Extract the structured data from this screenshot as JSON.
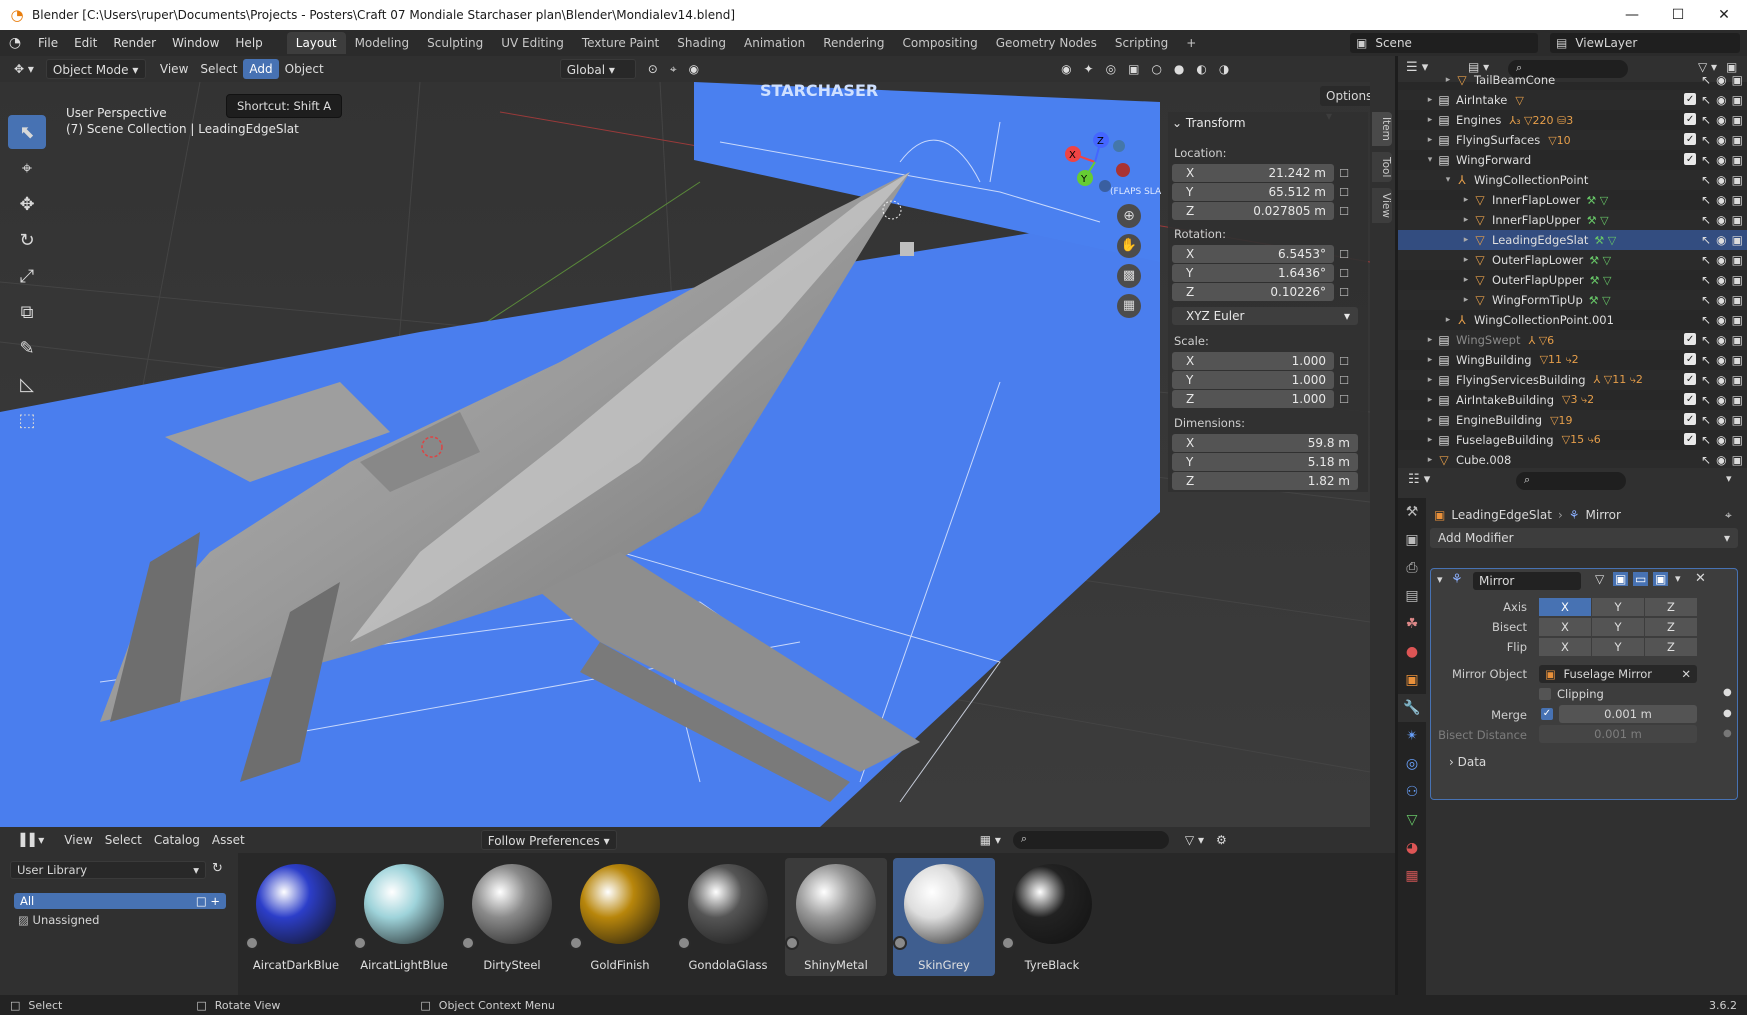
{
  "titlebar": {
    "title": "Blender [C:\\Users\\ruper\\Documents\\Projects - Posters\\Craft 07 Mondiale Starchaser plan\\Blender\\Mondialev14.blend]",
    "minimize": "—",
    "maximize": "☐",
    "close": "✕"
  },
  "menu": {
    "items": [
      "File",
      "Edit",
      "Render",
      "Window",
      "Help"
    ],
    "workspaces": [
      "Layout",
      "Modeling",
      "Sculpting",
      "UV Editing",
      "Texture Paint",
      "Shading",
      "Animation",
      "Rendering",
      "Compositing",
      "Geometry Nodes",
      "Scripting"
    ],
    "active_workspace": "Layout",
    "add_workspace": "+",
    "scene": "Scene",
    "view_layer": "ViewLayer"
  },
  "viewport_header": {
    "mode": "Object Mode",
    "menus": [
      "View",
      "Select",
      "Add",
      "Object"
    ],
    "active_menu": "Add",
    "orientation": "Global",
    "options": "Options"
  },
  "viewport": {
    "view_name": "User Perspective",
    "collection_info": "(7) Scene Collection | LeadingEdgeSlat",
    "tooltip": "Shortcut: Shift A",
    "blueprint_title": "STARCHASER",
    "blueprint_note": "(FLAPS SLA",
    "gizmo": {
      "x": "X",
      "y": "Y",
      "z": "Z"
    }
  },
  "transform": {
    "header": "Transform",
    "location_label": "Location:",
    "location": [
      {
        "axis": "X",
        "value": "21.242 m"
      },
      {
        "axis": "Y",
        "value": "65.512 m"
      },
      {
        "axis": "Z",
        "value": "0.027805 m"
      }
    ],
    "rotation_label": "Rotation:",
    "rotation": [
      {
        "axis": "X",
        "value": "6.5453°"
      },
      {
        "axis": "Y",
        "value": "1.6436°"
      },
      {
        "axis": "Z",
        "value": "0.10226°"
      }
    ],
    "rotation_mode": "XYZ Euler",
    "scale_label": "Scale:",
    "scale": [
      {
        "axis": "X",
        "value": "1.000"
      },
      {
        "axis": "Y",
        "value": "1.000"
      },
      {
        "axis": "Z",
        "value": "1.000"
      }
    ],
    "dimensions_label": "Dimensions:",
    "dimensions": [
      {
        "axis": "X",
        "value": "59.8 m"
      },
      {
        "axis": "Y",
        "value": "5.18 m"
      },
      {
        "axis": "Z",
        "value": "1.82 m"
      }
    ]
  },
  "sidetabs": [
    "Item",
    "Tool",
    "View"
  ],
  "outliner": {
    "rows": [
      {
        "name": "TailBeamCone",
        "indent": 2,
        "kind": "mesh"
      },
      {
        "name": "AirIntake",
        "indent": 1,
        "kind": "coll",
        "badge": "▽"
      },
      {
        "name": "Engines",
        "indent": 1,
        "kind": "coll",
        "badge": "⅄₃ ▽220 ⛁3"
      },
      {
        "name": "FlyingSurfaces",
        "indent": 1,
        "kind": "coll",
        "badge": "▽10"
      },
      {
        "name": "WingForward",
        "indent": 1,
        "kind": "coll",
        "open": true
      },
      {
        "name": "WingCollectionPoint",
        "indent": 2,
        "kind": "empty",
        "open": true
      },
      {
        "name": "InnerFlapLower",
        "indent": 3,
        "kind": "mesh"
      },
      {
        "name": "InnerFlapUpper",
        "indent": 3,
        "kind": "mesh"
      },
      {
        "name": "LeadingEdgeSlat",
        "indent": 3,
        "kind": "mesh",
        "selected": true
      },
      {
        "name": "OuterFlapLower",
        "indent": 3,
        "kind": "mesh"
      },
      {
        "name": "OuterFlapUpper",
        "indent": 3,
        "kind": "mesh"
      },
      {
        "name": "WingFormTipUp",
        "indent": 3,
        "kind": "mesh"
      },
      {
        "name": "WingCollectionPoint.001",
        "indent": 2,
        "kind": "empty"
      },
      {
        "name": "WingSwept",
        "indent": 1,
        "kind": "coll",
        "badge": "⅄ ▽6",
        "dim": true
      },
      {
        "name": "WingBuilding",
        "indent": 1,
        "kind": "coll",
        "badge": "▽11 ⤷2"
      },
      {
        "name": "FlyingServicesBuilding",
        "indent": 1,
        "kind": "coll",
        "badge": "⅄ ▽11 ⤷2"
      },
      {
        "name": "AirIntakeBuilding",
        "indent": 1,
        "kind": "coll",
        "badge": "▽3 ⤷2"
      },
      {
        "name": "EngineBuilding",
        "indent": 1,
        "kind": "coll",
        "badge": "▽19"
      },
      {
        "name": "FuselageBuilding",
        "indent": 1,
        "kind": "coll",
        "badge": "▽15 ⤷6"
      },
      {
        "name": "Cube.008",
        "indent": 1,
        "kind": "mesh"
      }
    ]
  },
  "properties": {
    "breadcrumb_object": "LeadingEdgeSlat",
    "breadcrumb_sep": "›",
    "breadcrumb_modifier": "Mirror",
    "add_modifier": "Add Modifier",
    "modifier_name": "Mirror",
    "axis_label": "Axis",
    "bisect_label": "Bisect",
    "flip_label": "Flip",
    "axes": [
      "X",
      "Y",
      "Z"
    ],
    "mirror_object_label": "Mirror Object",
    "mirror_object": "Fuselage Mirror",
    "clipping_label": "Clipping",
    "merge_label": "Merge",
    "merge_value": "0.001 m",
    "bisect_distance_label": "Bisect Distance",
    "bisect_distance_value": "0.001 m",
    "data_section": "Data"
  },
  "asset_browser": {
    "menus": [
      "View",
      "Select",
      "Catalog",
      "Asset"
    ],
    "import_method": "Follow Preferences",
    "library": "User Library",
    "catalogs": [
      "All",
      "Unassigned"
    ],
    "assets": [
      {
        "name": "AircatDarkBlue",
        "color": "#2c3ec9"
      },
      {
        "name": "AircatLightBlue",
        "color": "#9ed3da"
      },
      {
        "name": "DirtySteel",
        "color": "#8a8a8a"
      },
      {
        "name": "GoldFinish",
        "color": "#b8860b"
      },
      {
        "name": "GondolaGlass",
        "color": "#555555"
      },
      {
        "name": "ShinyMetal",
        "color": "#9a9a9a"
      },
      {
        "name": "SkinGrey",
        "color": "#dedede"
      },
      {
        "name": "TyreBlack",
        "color": "#222222"
      }
    ],
    "selected_asset": "SkinGrey"
  },
  "statusbar": {
    "select": "Select",
    "rotate": "Rotate View",
    "context": "Object Context Menu",
    "version": "3.6.2"
  }
}
